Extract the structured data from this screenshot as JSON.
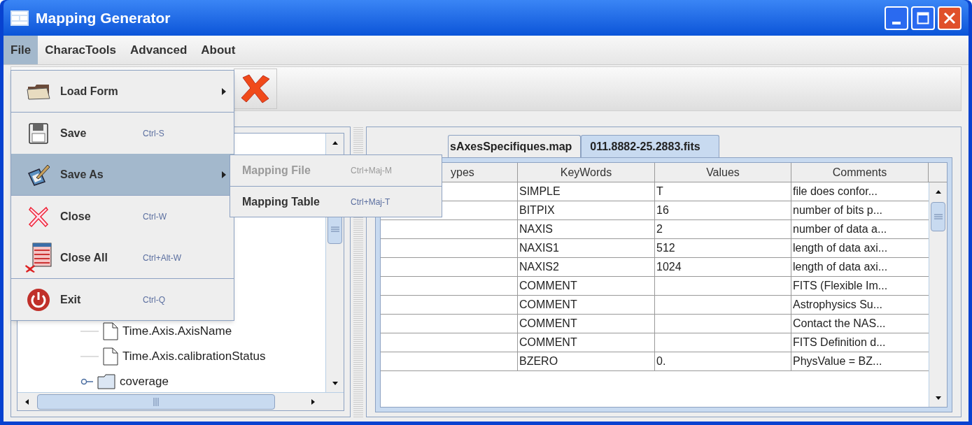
{
  "window": {
    "title": "Mapping Generator"
  },
  "menu_bar": [
    {
      "label": "File",
      "selected": true
    },
    {
      "label": "CharacTools",
      "selected": false
    },
    {
      "label": "Advanced",
      "selected": false
    },
    {
      "label": "About",
      "selected": false
    }
  ],
  "file_menu": {
    "groups": [
      [
        {
          "label": "Load Form",
          "submenu": true,
          "selected": false
        }
      ],
      [
        {
          "label": "Save",
          "shortcut": "Ctrl-S",
          "selected": false
        },
        {
          "label": "Save As",
          "submenu": true,
          "selected": true
        }
      ],
      [
        {
          "label": "Close",
          "shortcut": "Ctrl-W",
          "selected": false
        },
        {
          "label": "Close All",
          "shortcut": "Ctrl+Alt-W",
          "selected": false
        }
      ],
      [
        {
          "label": "Exit",
          "shortcut": "Ctrl-Q",
          "selected": false
        }
      ]
    ]
  },
  "submenu": {
    "items": [
      {
        "label": "Mapping File",
        "shortcut": "Ctrl+Maj-M",
        "disabled": true
      },
      {
        "label": "Mapping Table",
        "shortcut": "Ctrl+Maj-T",
        "disabled": false
      }
    ]
  },
  "tree": {
    "items": [
      {
        "label": "Time.Axis.AxisName",
        "kind": "leaf"
      },
      {
        "label": "Time.Axis.calibrationStatus",
        "kind": "leaf"
      },
      {
        "label": "coverage",
        "kind": "folder",
        "expanded": false
      }
    ]
  },
  "tabs": [
    {
      "label": "sAxesSpecifiques.map",
      "selected": false
    },
    {
      "label": "011.8882-25.2883.fits",
      "selected": true
    }
  ],
  "table": {
    "columns": [
      "ypes",
      "KeyWords",
      "Values",
      "Comments"
    ],
    "rows": [
      {
        "keyword": "SIMPLE",
        "value": "T",
        "comment": "file does confor..."
      },
      {
        "keyword": "BITPIX",
        "value": "16",
        "comment": "number of bits p..."
      },
      {
        "keyword": "NAXIS",
        "value": "2",
        "comment": "number of data a..."
      },
      {
        "keyword": "NAXIS1",
        "value": "512",
        "comment": "length of data axi..."
      },
      {
        "keyword": "NAXIS2",
        "value": "1024",
        "comment": "length of data axi..."
      },
      {
        "keyword": "COMMENT",
        "comment": "FITS (Flexible Im..."
      },
      {
        "keyword": "COMMENT",
        "comment": "Astrophysics Su..."
      },
      {
        "keyword": "COMMENT",
        "comment": "Contact the NAS..."
      },
      {
        "keyword": "COMMENT",
        "comment": "FITS Definition d..."
      },
      {
        "keyword": "BZERO",
        "value": "0.",
        "comment": "PhysValue = BZ..."
      }
    ]
  }
}
